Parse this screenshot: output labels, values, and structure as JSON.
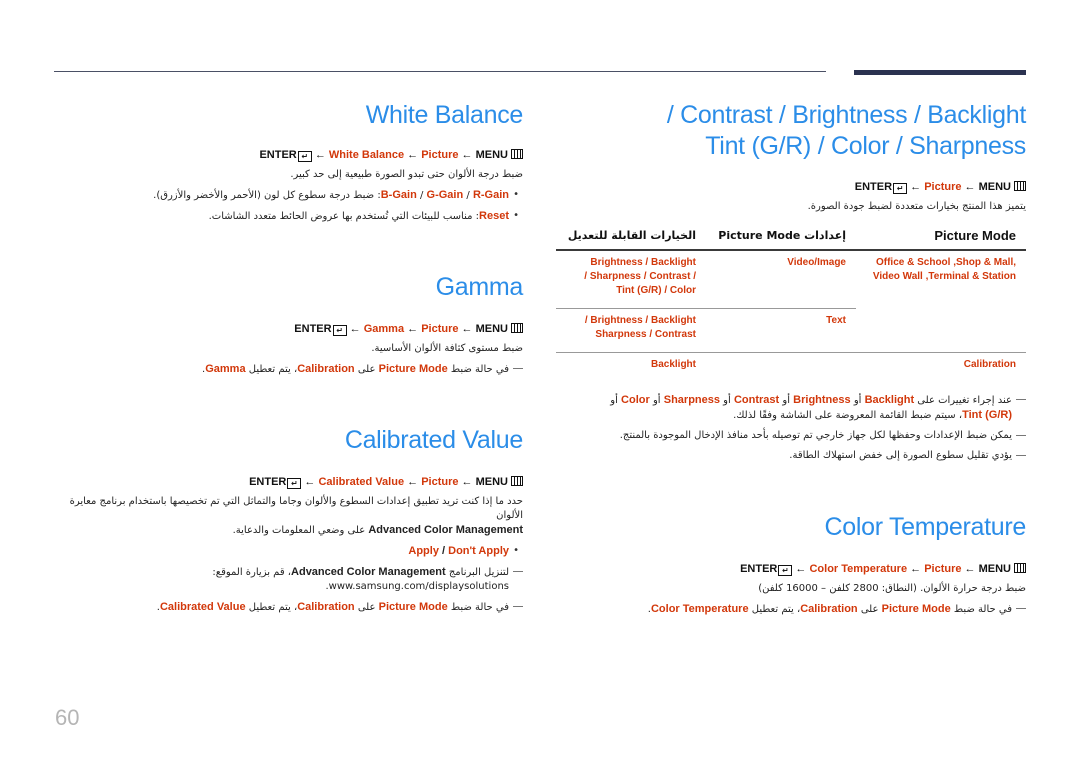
{
  "page": {
    "number": "60"
  },
  "sections": {
    "white_balance": {
      "title": "White Balance",
      "nav": {
        "enter": "ENTER",
        "item": "White Balance",
        "picture": "Picture",
        "menu": "MENU",
        "arrow": "←"
      },
      "desc": "ضبط درجة الألوان حتى تبدو الصورة طبيعية إلى حد كبير.",
      "bullets": [
        {
          "term_r": "R-Gain",
          "term_g": "G-Gain",
          "term_b": "B-Gain",
          "text": ": ضبط درجة سطوع كل لون (الأحمر والأخضر والأزرق)."
        },
        {
          "term": "Reset",
          "text": ": مناسب للبيئات التي تُستخدم بها عروض الحائط متعدد الشاشات."
        }
      ]
    },
    "gamma": {
      "title": "Gamma",
      "nav": {
        "enter": "ENTER",
        "item": "Gamma",
        "picture": "Picture",
        "menu": "MENU",
        "arrow": "←"
      },
      "desc": "ضبط مستوى كثافة الألوان الأساسية.",
      "note": {
        "pre": "في حالة ضبط ",
        "mode": "Picture Mode",
        "mid": " على ",
        "cal": "Calibration",
        "post": "، يتم تعطيل ",
        "item": "Gamma",
        "end": "."
      }
    },
    "calibrated_value": {
      "title": "Calibrated Value",
      "nav": {
        "enter": "ENTER",
        "item": "Calibrated Value",
        "picture": "Picture",
        "menu": "MENU",
        "arrow": "←"
      },
      "desc_1": "حدد ما إذا كنت تريد تطبيق إعدادات السطوع والألوان وجاما والتماثل التي تم تخصيصها باستخدام برنامج معايرة الألوان",
      "desc_term": "Advanced Color Management",
      "desc_2": " على وضعي المعلومات والدعاية.",
      "bullet": {
        "apply": "Apply",
        "sep": " / ",
        "dont_apply": "Don't Apply"
      },
      "note_download": {
        "pre": "لتنزيل البرنامج ",
        "term": "Advanced Color Management",
        "post": "، قم بزيارة الموقع:",
        "url": "www.samsung.com/displaysolutions."
      },
      "note": {
        "pre": "في حالة ضبط ",
        "mode": "Picture Mode",
        "mid": " على ",
        "cal": "Calibration",
        "post": "، يتم تعطيل ",
        "item": "Calibrated Value",
        "end": "."
      }
    },
    "backlight": {
      "title_line1": "/ Contrast / Brightness / Backlight",
      "title_line2": "Tint (G/R) / Color / Sharpness",
      "nav": {
        "enter": "ENTER",
        "picture": "Picture",
        "menu": "MENU",
        "arrow": "←"
      },
      "desc": "يتميز هذا المنتج بخيارات متعددة لضبط جودة الصورة.",
      "table": {
        "headers": [
          "Picture Mode",
          "إعدادات Picture Mode",
          "الخيارات القابلة للتعديل"
        ],
        "rows": [
          {
            "mode": ",Office & School ,Shop & Mall Video Wall ,Terminal & Station",
            "setting": "Video/Image",
            "options_l1": "Brightness  / Backlight",
            "options_l2": "/ Sharpness / Contrast /",
            "options_l3": "Tint (G/R) / Color"
          },
          {
            "mode": "",
            "setting": "Text",
            "options_l1": "/ Brightness / Backlight",
            "options_l2": "Sharpness / Contrast"
          },
          {
            "mode": "Calibration",
            "setting": "",
            "options_l1": "Backlight"
          }
        ]
      },
      "notes": [
        {
          "pre": "عند إجراء تغييرات على ",
          "t1": "Backlight",
          "o1": " أو ",
          "t2": "Brightness",
          "o2": " أو ",
          "t3": "Contrast",
          "o3": " أو ",
          "t4": "Sharpness",
          "o4": " أو ",
          "t5": "Color",
          "o5": " أو ",
          "t6": "Tint (G/R)",
          "post": "، سيتم ضبط القائمة المعروضة على الشاشة وفقًا لذلك."
        },
        {
          "text": "يمكن ضبط الإعدادات وحفظها لكل جهاز خارجي تم توصيله بأحد منافذ الإدخال الموجودة بالمنتج."
        },
        {
          "text": "يؤدي تقليل سطوع الصورة إلى خفض استهلاك الطاقة."
        }
      ]
    },
    "color_temperature": {
      "title": "Color Temperature",
      "nav": {
        "enter": "ENTER",
        "item": "Color Temperature",
        "picture": "Picture",
        "menu": "MENU",
        "arrow": "←"
      },
      "desc": "ضبط درجة حرارة الألوان. (النطاق: 2800 كلفن – 16000 كلفن)",
      "note": {
        "pre": "في حالة ضبط ",
        "mode": "Picture Mode",
        "mid": " على ",
        "cal": "Calibration",
        "post": "، يتم تعطيل ",
        "item": "Color Temperature",
        "end": "."
      }
    }
  },
  "colors": {
    "heading": "#2b8de8",
    "accent": "#d2380b",
    "rule": "#2b3250",
    "page_number": "#b5b5b5"
  }
}
